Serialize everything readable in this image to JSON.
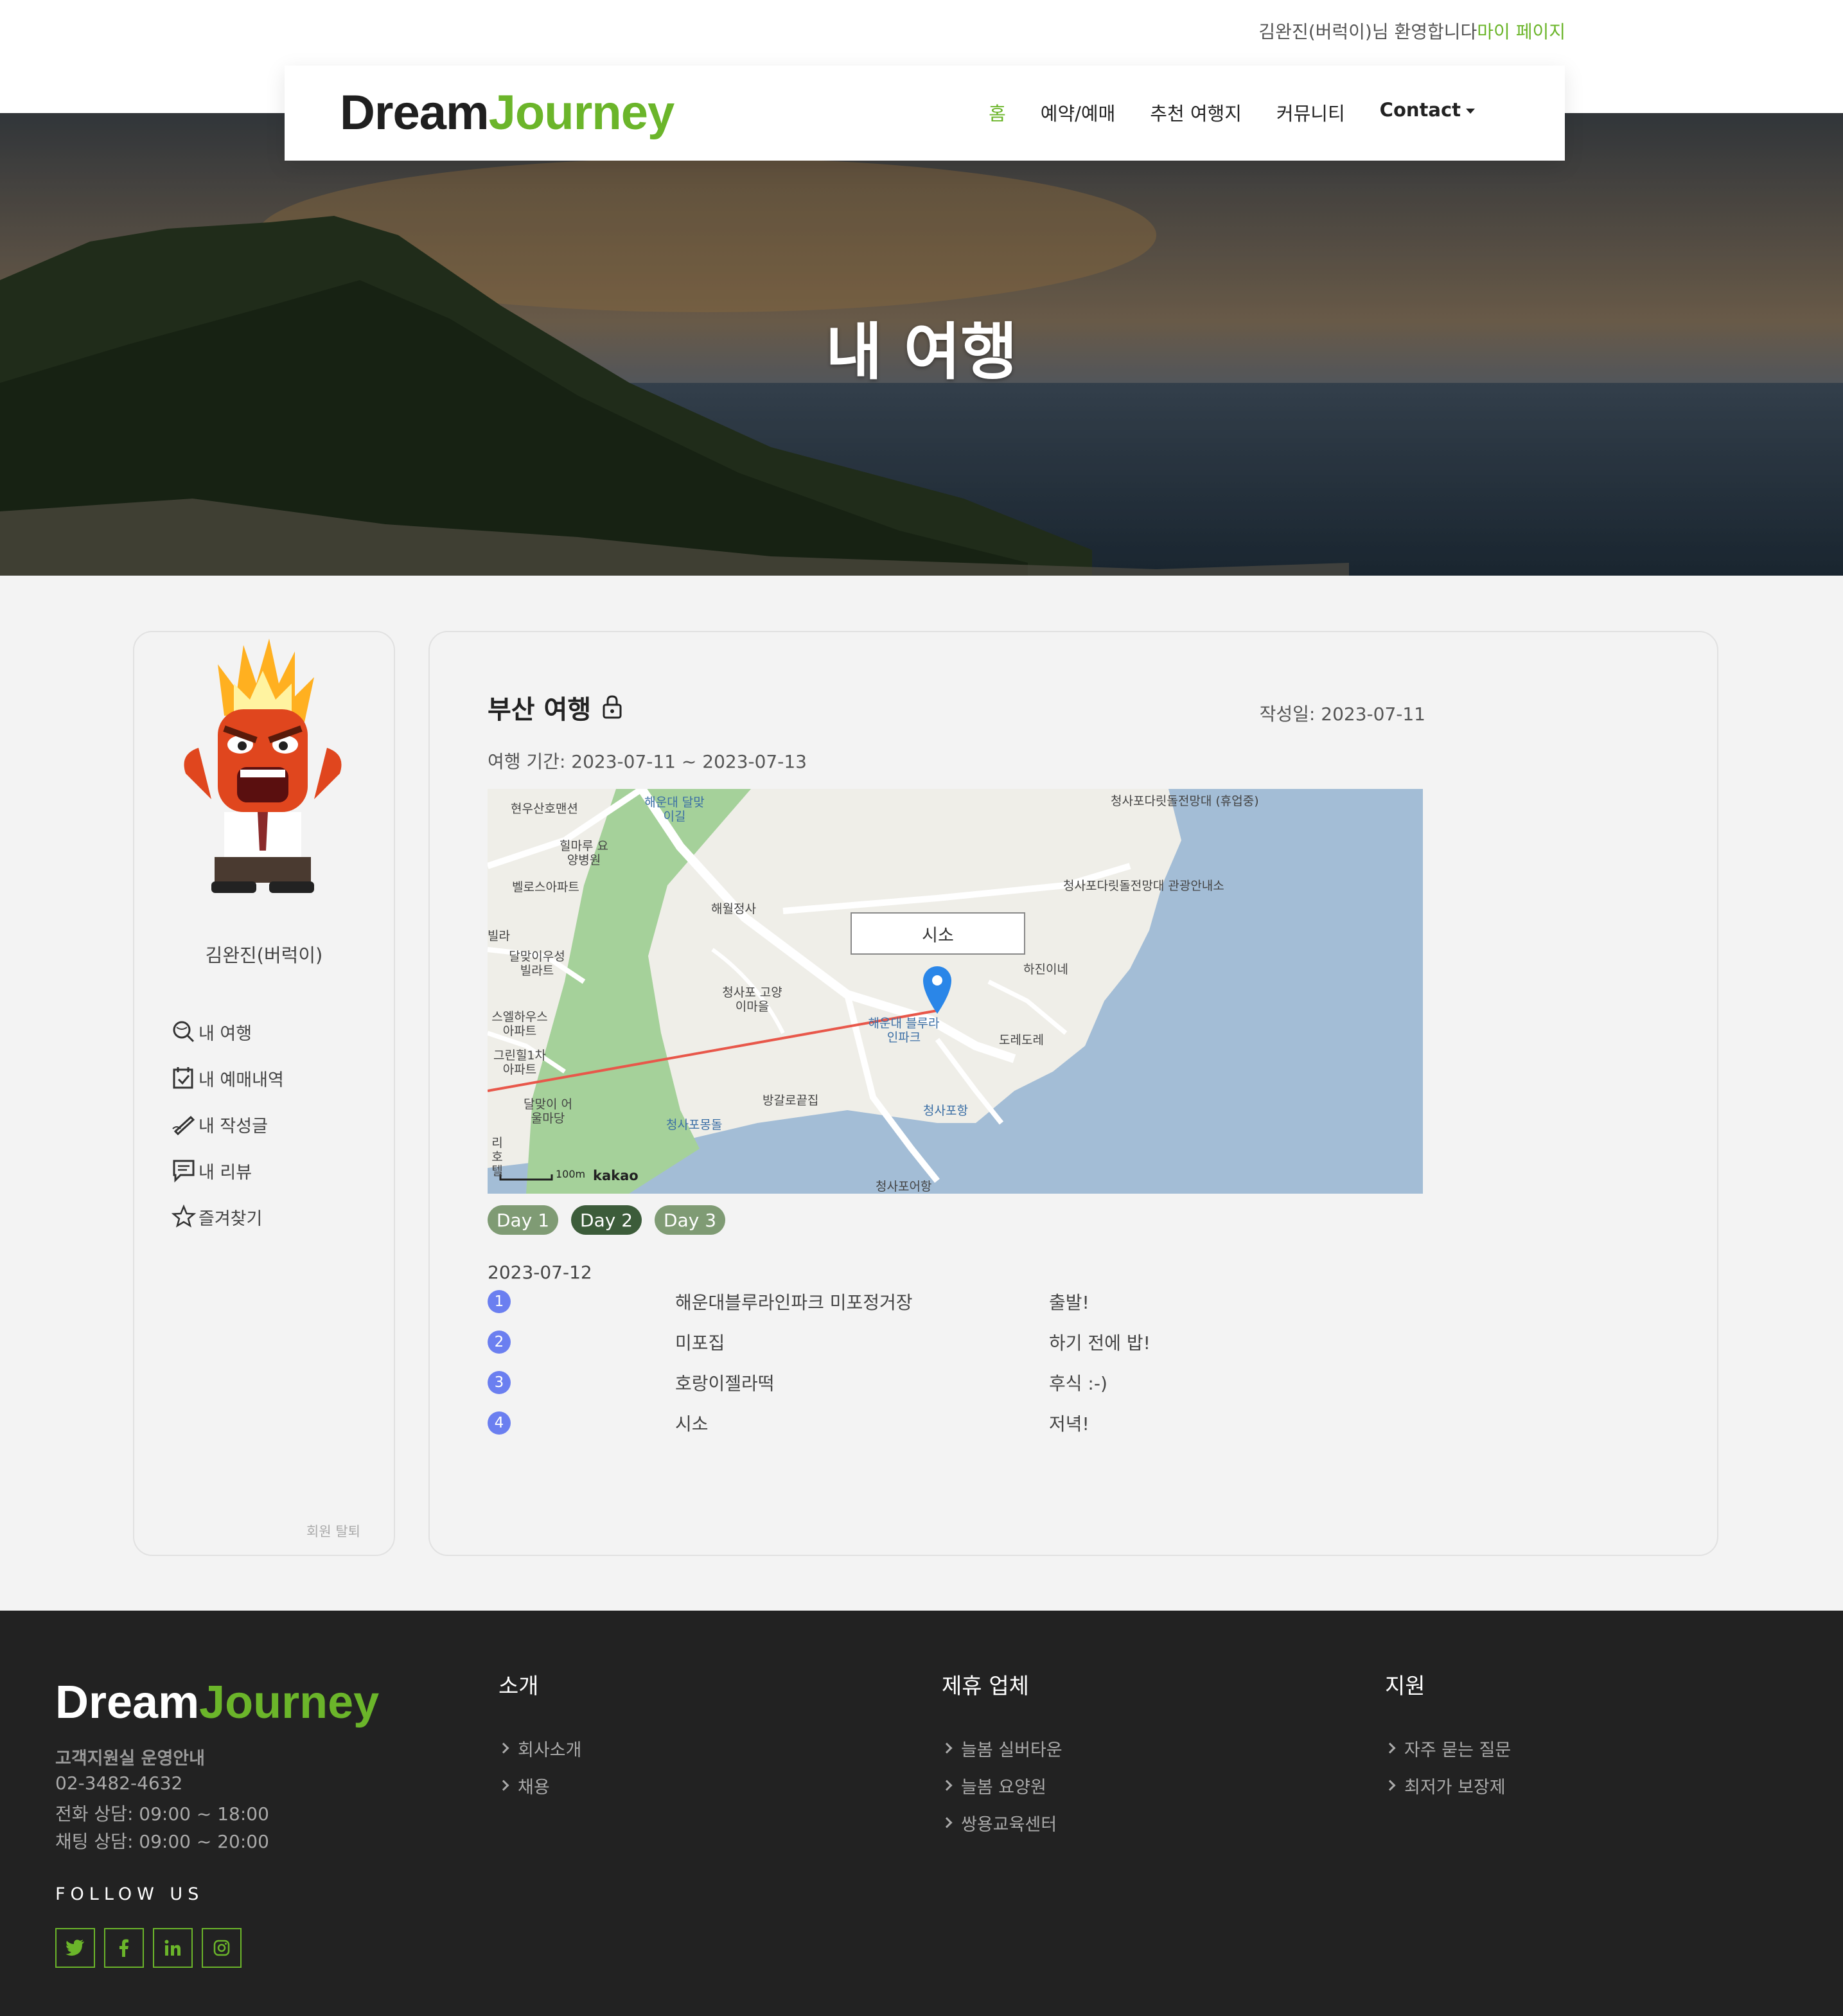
{
  "header": {
    "greeting": "김완진(버럭이)님 환영합니다",
    "mypage_link": "마이 페이지",
    "logo_part1": "Dream",
    "logo_part2": "Journey",
    "nav": [
      "홈",
      "예약/예매",
      "추천 여행지",
      "커뮤니티",
      "Contact"
    ],
    "active_nav": "홈"
  },
  "hero": {
    "title": "내 여행"
  },
  "sidebar": {
    "username": "김완진(버럭이)",
    "menu": [
      {
        "label": "내 여행",
        "icon": "search-globe-icon"
      },
      {
        "label": "내 예매내역",
        "icon": "calendar-check-icon"
      },
      {
        "label": "내 작성글",
        "icon": "pen-icon"
      },
      {
        "label": "내 리뷰",
        "icon": "review-icon"
      },
      {
        "label": "즐겨찾기",
        "icon": "star-icon"
      }
    ],
    "withdraw": "회원 탈퇴"
  },
  "trip": {
    "title": "부산 여행",
    "lock_icon": "lock-icon",
    "written_date": "작성일: 2023-07-11",
    "period": "여행 기간: 2023-07-11 ~ 2023-07-13",
    "map": {
      "callout": "시소",
      "scale": "100m",
      "brand": "kakao",
      "labels": [
        "현우산호맨션",
        "해운대 달맞이길",
        "힐마루 요양병원",
        "벨로스아파트",
        "해월정사",
        "청사포다릿돌전망대 (휴업중)",
        "청사포다릿돌전망대 관광안내소",
        "하진이네",
        "빌라",
        "달맞이우성 빌라트",
        "청사포 고양이마을",
        "해운대 블루라인파크",
        "도레도레",
        "스엘하우스 아파트",
        "그린힐1차 아파트",
        "방갈로끝집",
        "달맞이 어울마당",
        "청사포몽돌",
        "청사포항",
        "청사포어항",
        "리 호텔"
      ]
    },
    "days": [
      "Day 1",
      "Day 2",
      "Day 3"
    ],
    "selected_day": "Day 2",
    "date": "2023-07-12",
    "schedule": [
      {
        "n": "1",
        "place": "해운대블루라인파크 미포정거장",
        "memo": "출발!"
      },
      {
        "n": "2",
        "place": "미포집",
        "memo": "하기 전에 밥!"
      },
      {
        "n": "3",
        "place": "호랑이젤라떡",
        "memo": "후식 :-)"
      },
      {
        "n": "4",
        "place": "시소",
        "memo": "저녁!"
      }
    ]
  },
  "footer": {
    "logo_part1": "Dream",
    "logo_part2": "Journey",
    "cs_title": "고객지원실 운영안내",
    "phone": "02-3482-4632",
    "call_hours": "전화 상담: 09:00 ~ 18:00",
    "chat_hours": "채팅 상담: 09:00 ~ 20:00",
    "follow": "FOLLOW US",
    "socials": [
      "twitter-icon",
      "facebook-icon",
      "linkedin-icon",
      "instagram-icon"
    ],
    "col1": {
      "title": "소개",
      "items": [
        "회사소개",
        "채용"
      ]
    },
    "col2": {
      "title": "제휴 업체",
      "items": [
        "늘봄 실버타운",
        "늘봄 요양원",
        "쌍용교육센터"
      ]
    },
    "col3": {
      "title": "지원",
      "items": [
        "자주 묻는 질문",
        "최저가 보장제"
      ]
    }
  },
  "colors": {
    "brand_green": "#6bb52a",
    "day_selected": "#3c5c3a",
    "day": "#7f9b74",
    "step_badge": "#6b7ff0",
    "footer_bg": "#222222"
  }
}
